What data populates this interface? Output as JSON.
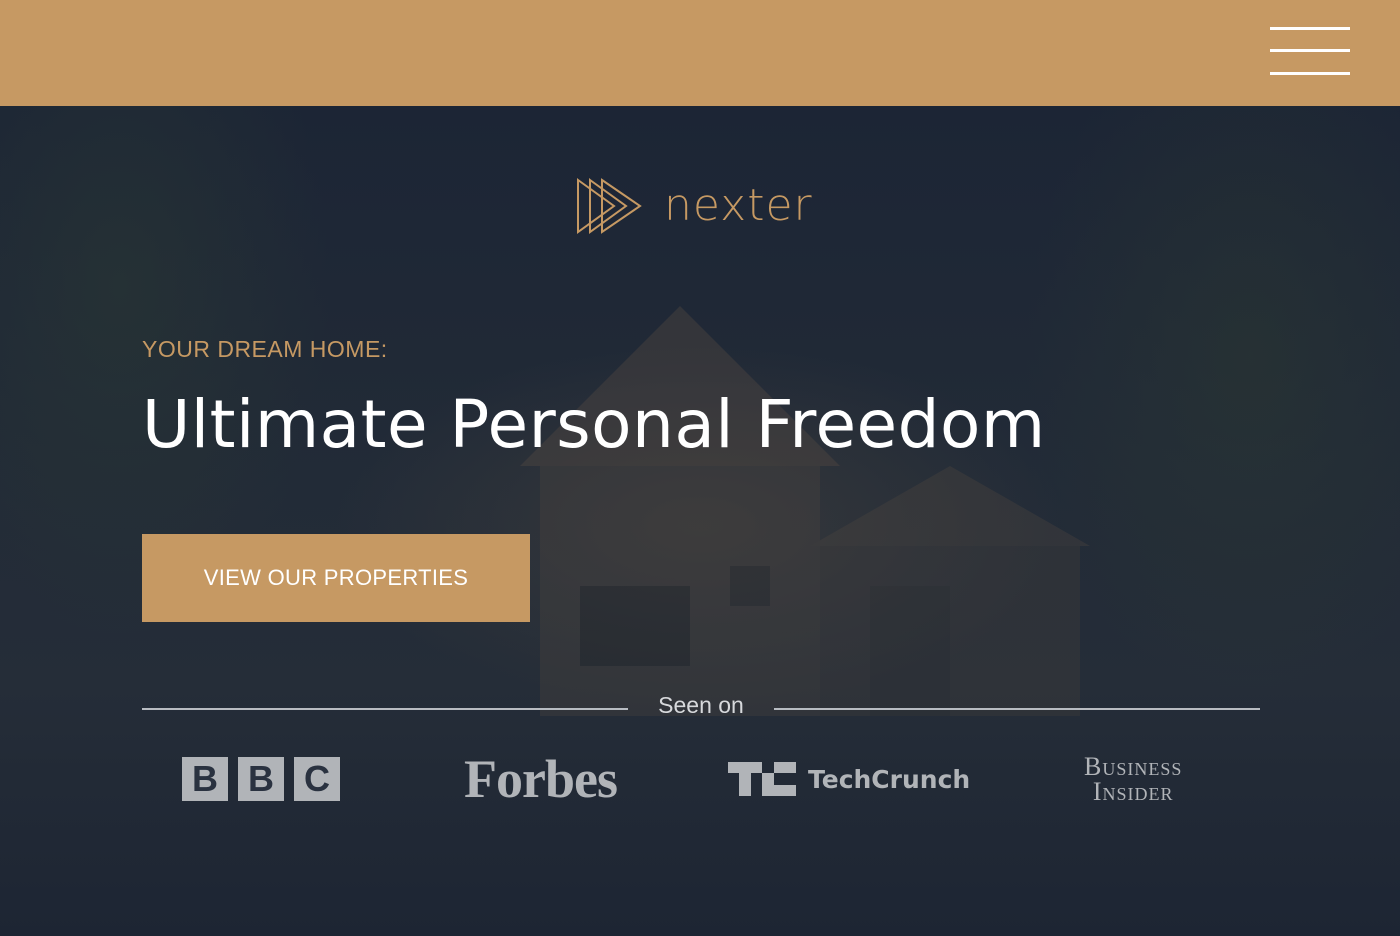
{
  "header": {
    "menu_label": "Open navigation menu"
  },
  "hero": {
    "logo_text": "nexter",
    "subtitle": "Your dream home:",
    "headline": "Ultimate Personal Freedom",
    "cta_label": "View our properties"
  },
  "seen_on": {
    "label": "Seen on",
    "brands": {
      "bbc": [
        "B",
        "B",
        "C"
      ],
      "forbes": "Forbes",
      "techcrunch": "TechCrunch",
      "business_insider": [
        "Business",
        "Insider"
      ]
    }
  },
  "colors": {
    "gold": "#c69963",
    "navy": "#1b2434",
    "white": "#ffffff",
    "logo_grey": "#b1b4b8"
  },
  "icons": {
    "menu": "hamburger-icon",
    "logo_mark": "triple-triangle-logo-icon",
    "techcrunch_mark": "techcrunch-icon"
  }
}
